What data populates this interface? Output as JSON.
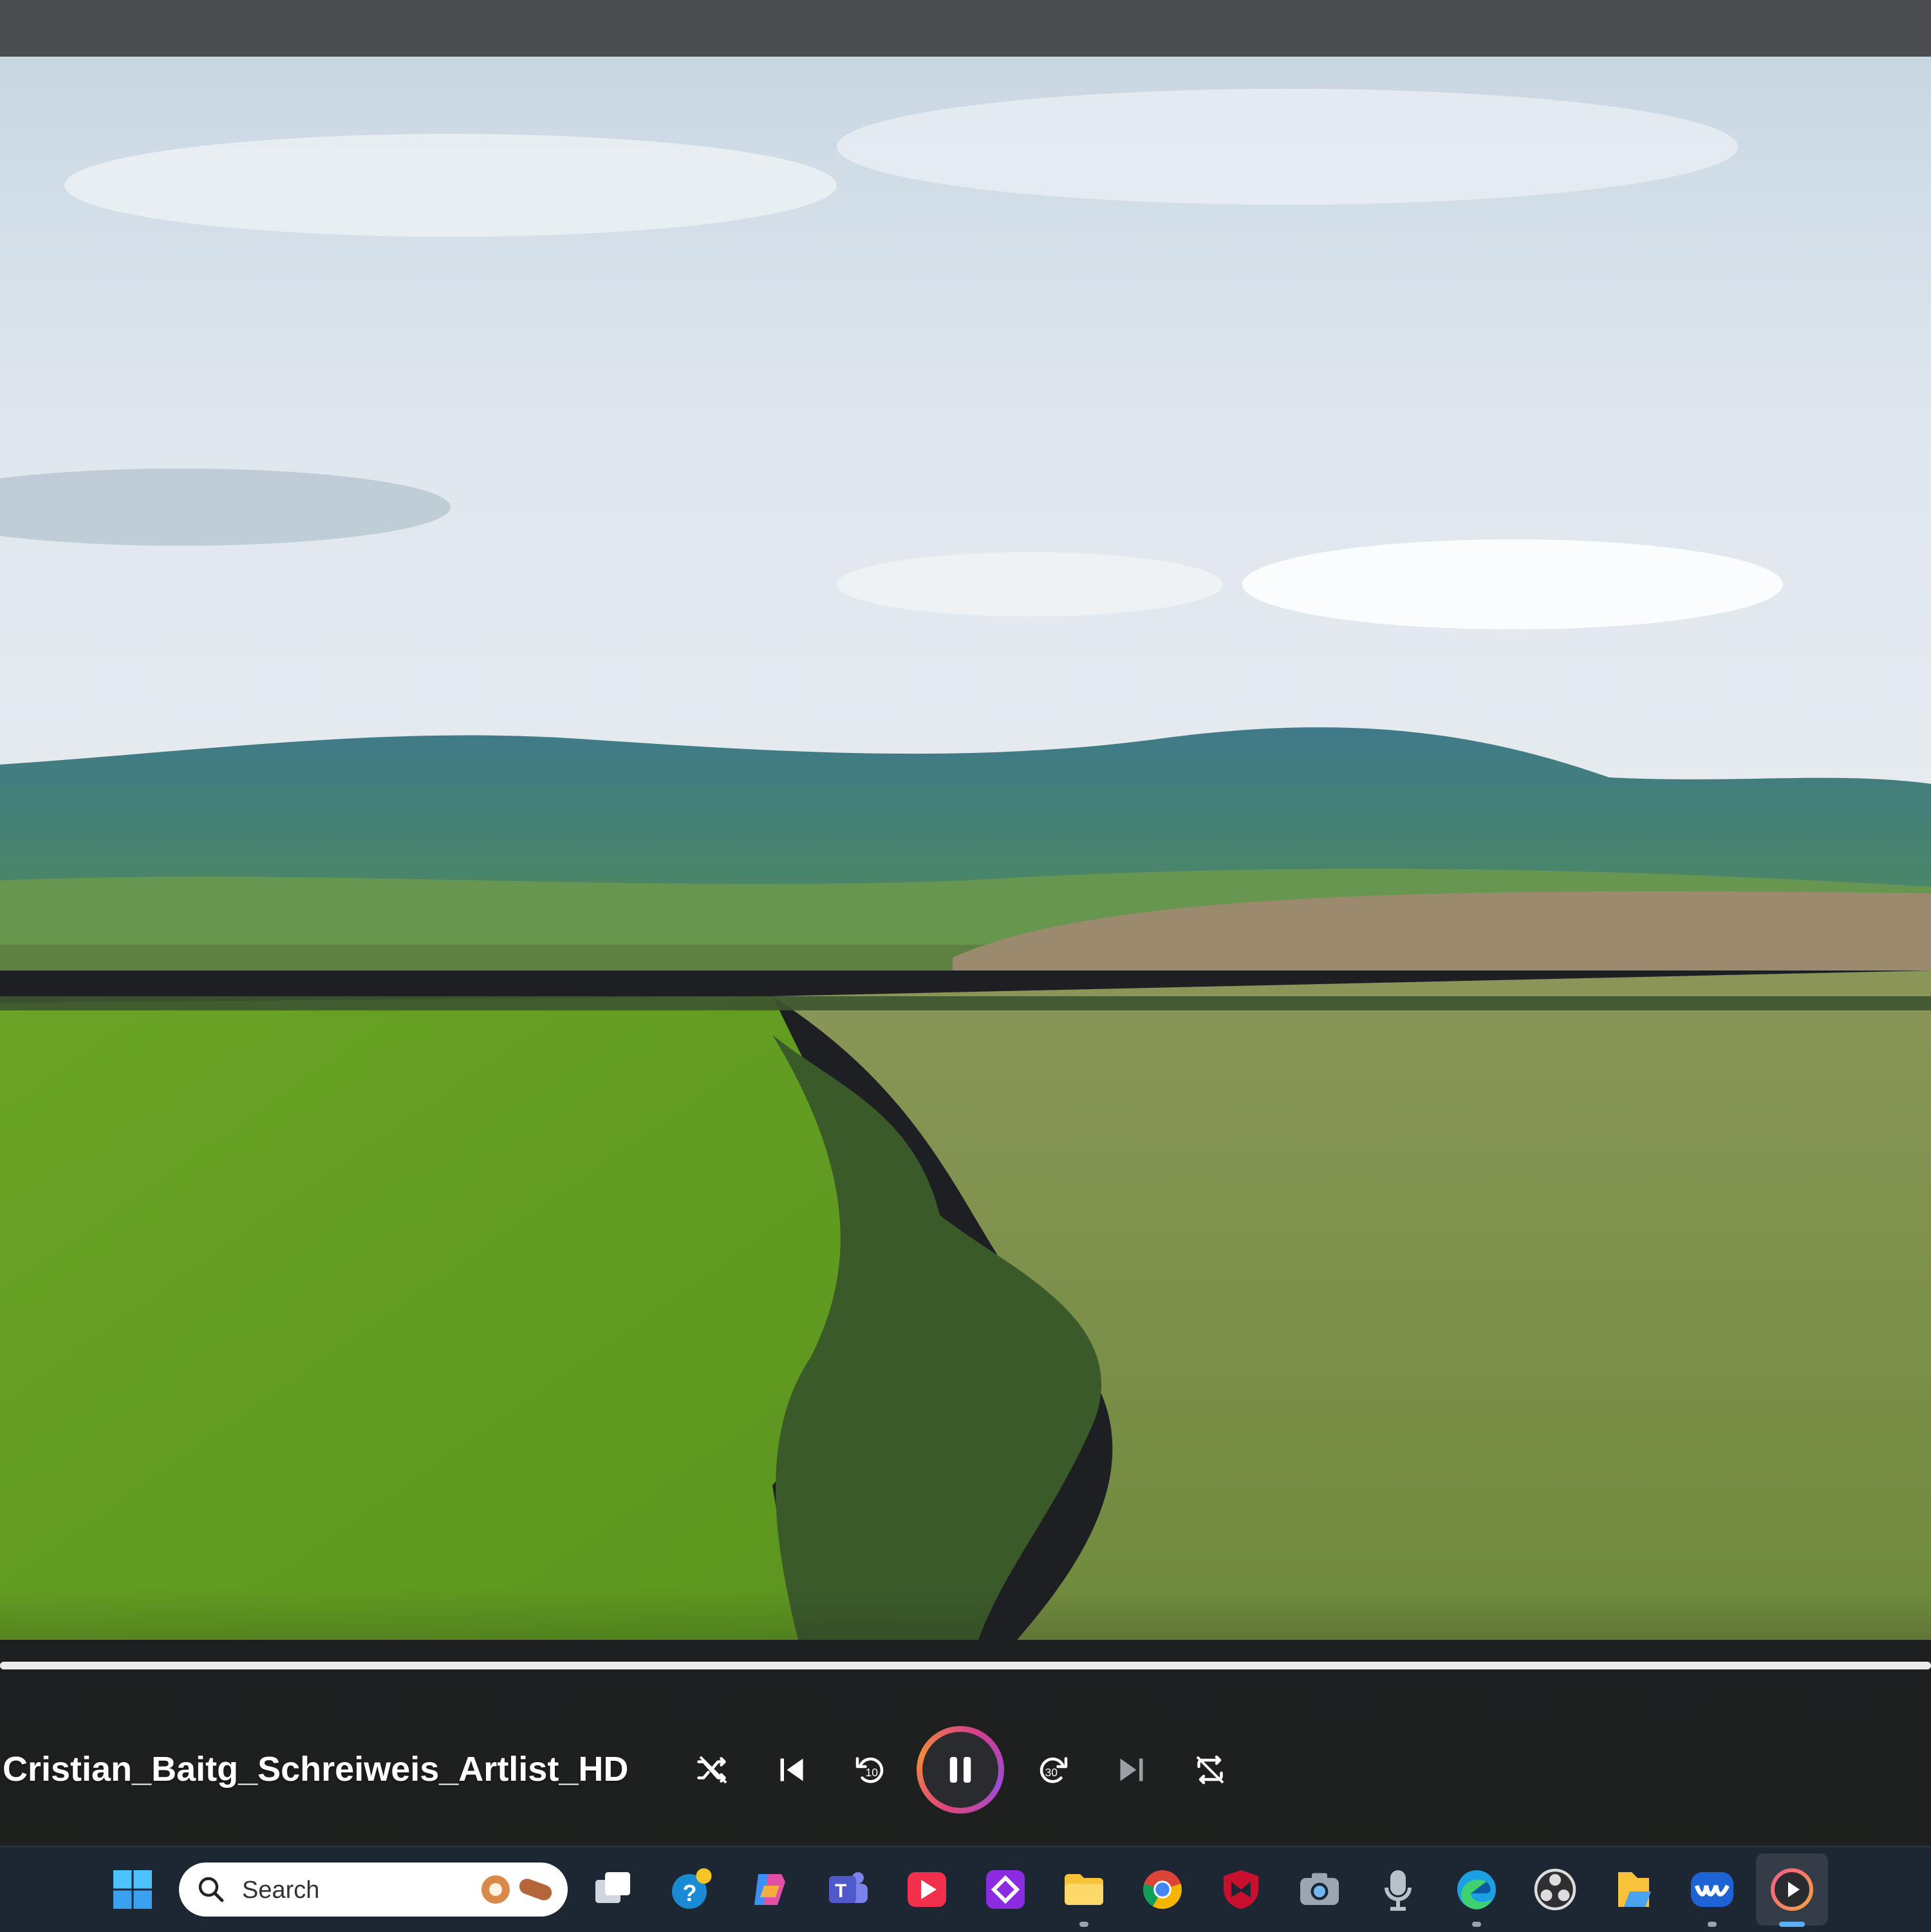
{
  "player": {
    "media_title": "Cristian_Baitg_Schreiweis_Artlist_HD",
    "progress": 1.0,
    "accent": "#e0457b"
  },
  "controls": {
    "shuffle_icon": "shuffle-icon",
    "previous_icon": "previous-icon",
    "rewind_icon": "rewind-10-icon",
    "pause_icon": "pause-icon",
    "forward_icon": "forward-30-icon",
    "next_icon": "next-icon",
    "repeat_icon": "repeat-off-icon"
  },
  "taskbar": {
    "search_placeholder": "Search",
    "apps": [
      "start",
      "search",
      "task-view",
      "get-help",
      "copilot",
      "teams",
      "video-app",
      "purple-app",
      "file-explorer",
      "chrome",
      "mcafee",
      "camera",
      "voice-recorder",
      "edge",
      "obs",
      "files",
      "waves",
      "media-player"
    ]
  }
}
